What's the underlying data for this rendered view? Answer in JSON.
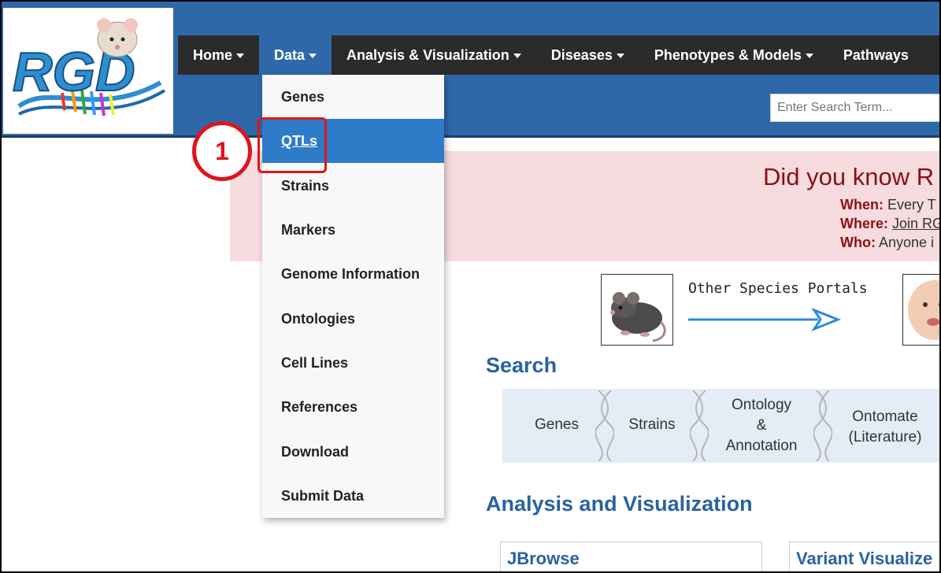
{
  "logo": {
    "text": "RGD"
  },
  "navbar": {
    "items": [
      {
        "label": "Home",
        "caret": true
      },
      {
        "label": "Data",
        "caret": true,
        "active": true
      },
      {
        "label": "Analysis & Visualization",
        "caret": true
      },
      {
        "label": "Diseases",
        "caret": true
      },
      {
        "label": "Phenotypes & Models",
        "caret": true
      },
      {
        "label": "Pathways",
        "caret": false
      }
    ]
  },
  "search": {
    "placeholder": "Enter Search Term..."
  },
  "did_you_know": {
    "title": "Did you know R",
    "when_label": "When:",
    "when_value": " Every T",
    "where_label": "Where:",
    "where_value": "Join RG",
    "who_label": "Who:",
    "who_value": " Anyone i"
  },
  "portals": {
    "label": "Other Species Portals"
  },
  "search_section": {
    "title": "Search",
    "items": [
      "Genes",
      "Strains",
      "Ontology\n&\nAnnotation",
      "Ontomate\n(Literature)"
    ]
  },
  "analysis_section": {
    "title": "Analysis and Visualization",
    "cards": [
      "JBrowse",
      "Variant Visualize"
    ]
  },
  "dropdown": {
    "items": [
      "Genes",
      "QTLs",
      "Strains",
      "Markers",
      "Genome Information",
      "Ontologies",
      "Cell Lines",
      "References",
      "Download",
      "Submit Data"
    ],
    "active_index": 1
  },
  "annotation": {
    "step": "1"
  },
  "colors": {
    "header": "#2e68a8",
    "navbar": "#2b2b2b",
    "accent": "#2e7cc7",
    "annotation": "#e0141c"
  }
}
